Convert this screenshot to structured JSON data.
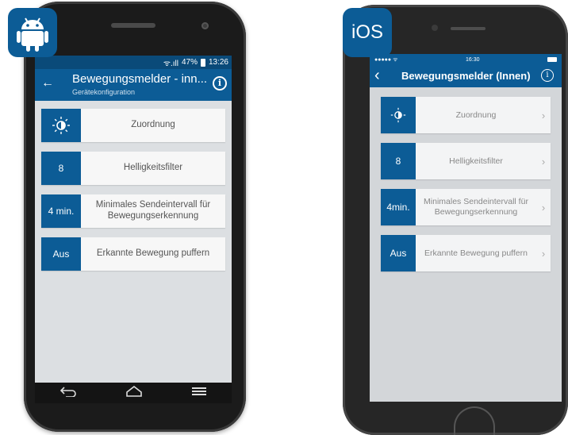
{
  "android": {
    "status": {
      "signal": "ᯤ.ıll",
      "battery": "47%",
      "time": "13:26"
    },
    "appbar": {
      "title": "Bewegungsmelder - inn...",
      "subtitle": "Gerätekonfiguration"
    },
    "items": [
      {
        "badge": "",
        "label": "Zuordnung"
      },
      {
        "badge": "8",
        "label": "Helligkeitsfilter"
      },
      {
        "badge": "4 min.",
        "label": "Minimales Sendeintervall für Bewegungserkennung"
      },
      {
        "badge": "Aus",
        "label": "Erkannte Bewegung puffern"
      }
    ]
  },
  "ios": {
    "badge_label": "iOS",
    "status": {
      "carrier": "●●●●● ᯤ",
      "time": "16:30"
    },
    "navbar": {
      "title": "Bewegungsmelder (Innen)"
    },
    "items": [
      {
        "badge": "",
        "label": "Zuordnung"
      },
      {
        "badge": "8",
        "label": "Helligkeitsfilter"
      },
      {
        "badge": "4min.",
        "label": "Minimales Sendeintervall für Bewegungserkennung"
      },
      {
        "badge": "Aus",
        "label": "Erkannte Bewegung puffern"
      }
    ]
  },
  "colors": {
    "brand": "#0c5c96",
    "status_bar": "#0a4a79"
  }
}
